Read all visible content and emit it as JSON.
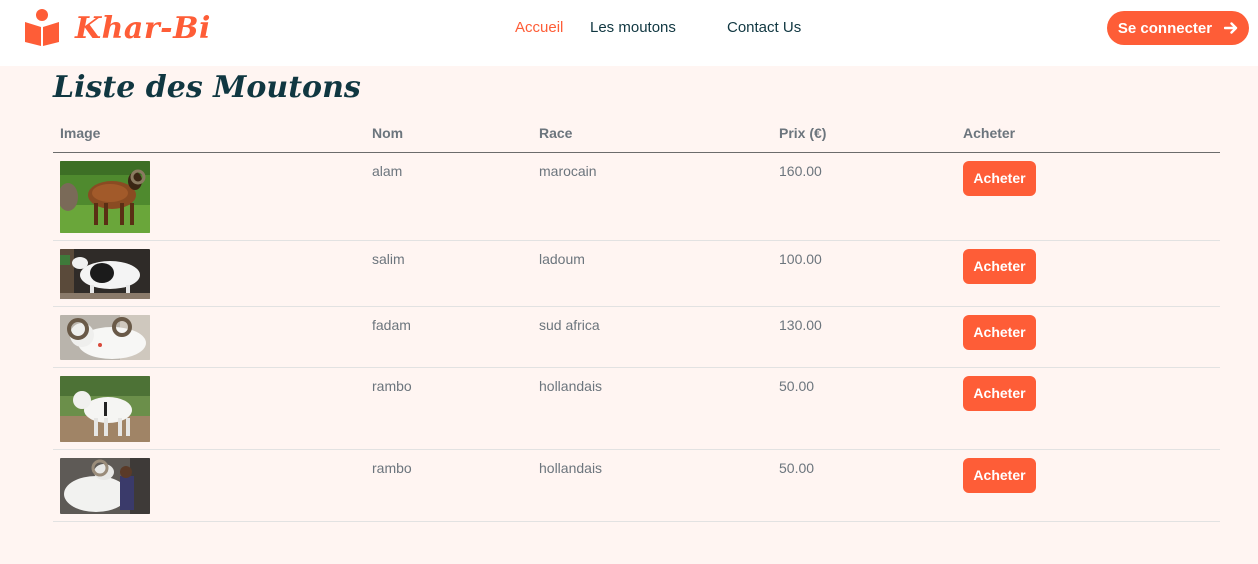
{
  "brand": {
    "name": "Khar-Bi",
    "icon": "book-reader-icon"
  },
  "nav": {
    "links": [
      {
        "label": "Accueil",
        "active": true
      },
      {
        "label": "Les moutons",
        "active": false
      },
      {
        "label": "Contact Us",
        "active": false
      }
    ],
    "login_label": "Se connecter",
    "login_icon": "arrow-right-icon"
  },
  "colors": {
    "accent": "#fe5d37",
    "dark": "#103741",
    "background": "#fff5f2"
  },
  "main": {
    "title": "Liste des Moutons",
    "table": {
      "headers": {
        "image": "Image",
        "nom": "Nom",
        "race": "Race",
        "prix": "Prix (€)",
        "acheter": "Acheter"
      },
      "rows": [
        {
          "nom": "alam",
          "race": "marocain",
          "prix": "160.00",
          "button": "Acheter",
          "photo": "brown-sheep-photo"
        },
        {
          "nom": "salim",
          "race": "ladoum",
          "prix": "100.00",
          "button": "Acheter",
          "photo": "black-white-sheep-photo"
        },
        {
          "nom": "fadam",
          "race": "sud africa",
          "prix": "130.00",
          "button": "Acheter",
          "photo": "white-ram-photo"
        },
        {
          "nom": "rambo",
          "race": "hollandais",
          "prix": "50.00",
          "button": "Acheter",
          "photo": "white-sheep-outdoor-photo"
        },
        {
          "nom": "rambo",
          "race": "hollandais",
          "prix": "50.00",
          "button": "Acheter",
          "photo": "white-ram-with-man-photo"
        }
      ]
    }
  }
}
